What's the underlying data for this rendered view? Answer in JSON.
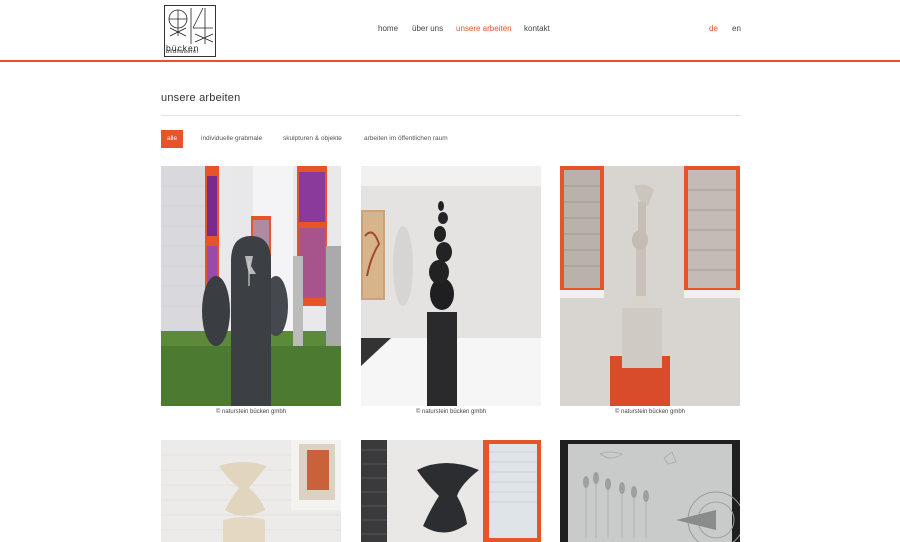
{
  "brand": {
    "word": "bücken",
    "sub": "bildhauerei"
  },
  "nav": {
    "items": [
      {
        "label": "home",
        "active": false
      },
      {
        "label": "über uns",
        "active": false
      },
      {
        "label": "unsere arbeiten",
        "active": true
      },
      {
        "label": "kontakt",
        "active": false
      }
    ]
  },
  "lang": {
    "de": "de",
    "en": "en",
    "active": "de"
  },
  "page": {
    "title": "unsere arbeiten"
  },
  "filters": [
    {
      "label": "alle",
      "active": true
    },
    {
      "label": "individuelle grabmale",
      "active": false
    },
    {
      "label": "skulpturen & objekte",
      "active": false
    },
    {
      "label": "arbeiten im öffentlichen raum",
      "active": false
    }
  ],
  "gallery": [
    {
      "alt": "sculpted grave stone in garden courtyard",
      "caption": "© naturstein bücken gmbh"
    },
    {
      "alt": "black spiral stone sculpture on pedestal",
      "caption": "© naturstein bücken gmbh"
    },
    {
      "alt": "light stone figure on red stand by window",
      "caption": "© naturstein bücken gmbh"
    },
    {
      "alt": "cream curved stone sculpture",
      "caption": ""
    },
    {
      "alt": "dark curved stone sculpture",
      "caption": ""
    },
    {
      "alt": "engraved stone relief with wheat and bird",
      "caption": ""
    }
  ],
  "colors": {
    "accent": "#e8542a",
    "text": "#333333",
    "divider": "#e4e4e4"
  }
}
